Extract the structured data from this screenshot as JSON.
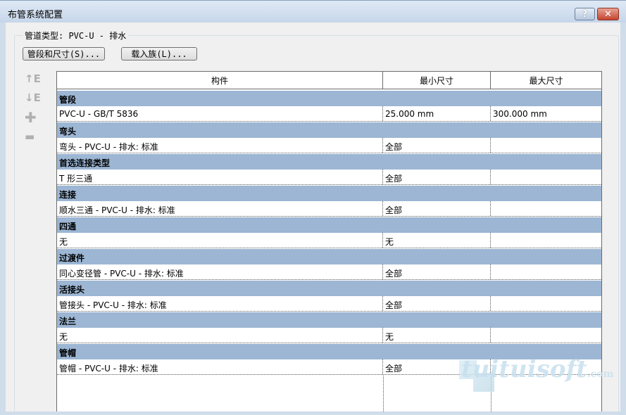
{
  "window": {
    "title": "布管系统配置",
    "help": "?",
    "close": "✕"
  },
  "pipe_type_label": "管道类型: PVC-U - 排水",
  "buttons": {
    "segments": "管段和尺寸(S)...",
    "load_family": "载入族(L)..."
  },
  "side_icons": [
    "move-up",
    "move-down",
    "add",
    "remove"
  ],
  "table": {
    "headers": [
      "构件",
      "最小尺寸",
      "最大尺寸"
    ],
    "groups": [
      {
        "name": "管段",
        "row": [
          "PVC-U - GB/T 5836",
          "25.000 mm",
          "300.000 mm"
        ]
      },
      {
        "name": "弯头",
        "row": [
          "弯头 - PVC-U - 排水: 标准",
          "全部",
          ""
        ]
      },
      {
        "name": "首选连接类型",
        "row": [
          "T 形三通",
          "全部",
          ""
        ]
      },
      {
        "name": "连接",
        "row": [
          "顺水三通 - PVC-U - 排水: 标准",
          "全部",
          ""
        ]
      },
      {
        "name": "四通",
        "row": [
          "无",
          "无",
          ""
        ]
      },
      {
        "name": "过渡件",
        "row": [
          "同心变径管 - PVC-U - 排水: 标准",
          "全部",
          ""
        ]
      },
      {
        "name": "活接头",
        "row": [
          "管接头 - PVC-U - 排水: 标准",
          "全部",
          ""
        ]
      },
      {
        "name": "法兰",
        "row": [
          "无",
          "无",
          ""
        ]
      },
      {
        "name": "管帽",
        "row": [
          "管帽 - PVC-U - 排水: 标准",
          "全部",
          ""
        ]
      }
    ]
  },
  "watermark": {
    "text": "tuituisoft",
    "suffix": ".com"
  }
}
